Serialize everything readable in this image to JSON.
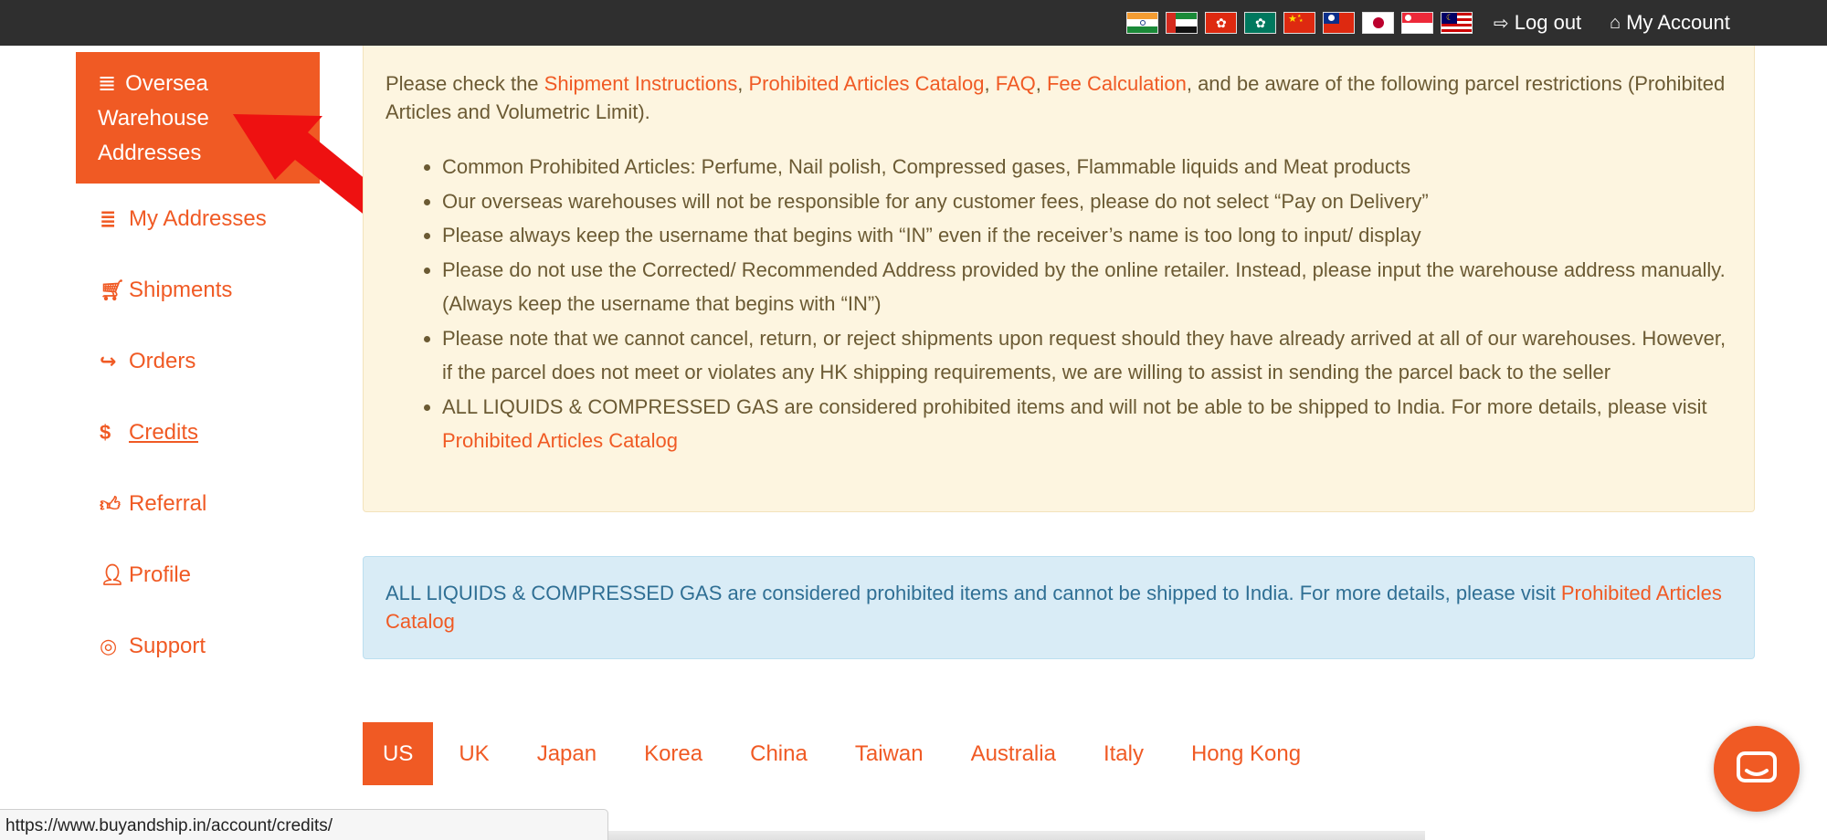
{
  "topbar": {
    "flags": [
      "India",
      "UAE",
      "Hong Kong",
      "Macau",
      "China",
      "Taiwan",
      "Japan",
      "Singapore",
      "Malaysia"
    ],
    "logout_label": "Log out",
    "logout_icon": "sign-out-icon",
    "account_label": "My Account",
    "account_icon": "home-icon"
  },
  "sidebar": {
    "active": {
      "line1": "Oversea",
      "line2": "Warehouse",
      "line3": "Addresses",
      "icon": "list-icon"
    },
    "items": [
      {
        "label": "My Addresses",
        "icon": "list-icon"
      },
      {
        "label": "Shipments",
        "icon": "cart-icon"
      },
      {
        "label": "Orders",
        "icon": "share-icon"
      },
      {
        "label": "Credits",
        "icon": "dollar-icon"
      },
      {
        "label": "Referral",
        "icon": "thumbs-up-icon"
      },
      {
        "label": "Profile",
        "icon": "user-icon"
      },
      {
        "label": "Support",
        "icon": "lifebuoy-icon"
      }
    ]
  },
  "notice": {
    "intro_pre": "Please check the ",
    "link_shipment": "Shipment Instructions",
    "sep1": ", ",
    "link_prohibited": "Prohibited Articles Catalog",
    "sep2": ", ",
    "link_faq": "FAQ",
    "sep3": ", ",
    "link_fee": "Fee Calculation",
    "intro_post": ", and be aware of the following parcel restrictions (Prohibited Articles and Volumetric Limit).",
    "bullets": [
      "Common Prohibited Articles: Perfume, Nail polish, Compressed gases, Flammable liquids and Meat products",
      "Our overseas warehouses will not be responsible for any customer fees, please do not select “Pay on Delivery”",
      "Please always keep the username that begins with “IN” even if the receiver’s name is too long to input/ display",
      "Please do not use the Corrected/ Recommended Address provided by the online retailer. Instead, please input the warehouse address manually. (Always keep the username that begins with “IN”)",
      "Please note that we cannot cancel, return, or reject shipments upon request should they have already arrived at all of our warehouses. However, if the parcel does not meet or violates any HK shipping requirements, we are willing to assist in sending the parcel back to the seller"
    ],
    "last_bullet_text": "ALL LIQUIDS & COMPRESSED GAS are considered prohibited items and will not be able to be shipped to India. For more details, please visit ",
    "last_bullet_link": "Prohibited Articles Catalog"
  },
  "info": {
    "text": "ALL LIQUIDS & COMPRESSED GAS are considered prohibited items and cannot be shipped to India. For more details, please visit ",
    "link": "Prohibited Articles Catalog"
  },
  "tabs": [
    "US",
    "UK",
    "Japan",
    "Korea",
    "China",
    "Taiwan",
    "Australia",
    "Italy",
    "Hong Kong"
  ],
  "statusbar": {
    "url": "https://www.buyandship.in/account/credits/"
  },
  "colors": {
    "accent": "#f05a24",
    "topbar": "#2f2f2f",
    "notice_bg": "#fdf5e0",
    "info_bg": "#d9ecf6"
  }
}
